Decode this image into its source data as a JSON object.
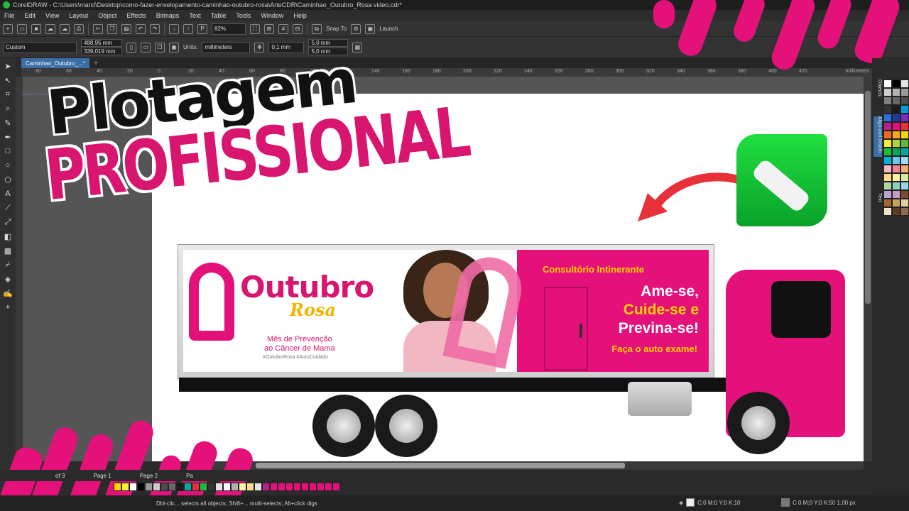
{
  "window": {
    "title": "CorelDRAW - C:\\Users\\marci\\Desktop\\como-fazer-envelopamento-caminhao-outubro-rosa\\ArteCDR\\Caminhao_Outubro_Rosa video.cdr*"
  },
  "menu": [
    "File",
    "Edit",
    "View",
    "Layout",
    "Object",
    "Effects",
    "Bitmaps",
    "Text",
    "Table",
    "Tools",
    "Window",
    "Help"
  ],
  "toolbar": {
    "zoom": "82%",
    "snap_to": "Snap To",
    "launch": "Launch"
  },
  "property_bar": {
    "page_size": "Custom",
    "width": "488,95 mm",
    "height": "339,019 mm",
    "units_label": "Units:",
    "units": "millimeters",
    "nudge": "0,1 mm",
    "dup_x": "5,0 mm",
    "dup_y": "5,0 mm"
  },
  "document_tab": "Caminhao_Outubro_...*",
  "ruler": {
    "labels": [
      "80",
      "60",
      "40",
      "20",
      "0",
      "20",
      "40",
      "60",
      "80",
      "100",
      "120",
      "140",
      "160",
      "180",
      "200",
      "220",
      "240",
      "260",
      "280",
      "300",
      "320",
      "340",
      "360",
      "380",
      "400",
      "420"
    ],
    "units": "millimeters"
  },
  "headline": {
    "line1": "Plotagem",
    "line2": "PROFISSIONAL"
  },
  "truck_banner": {
    "brand": "Outubro",
    "brand_sub": "Rosa",
    "slogan_1": "Mês de Prevenção",
    "slogan_2": "ao Câncer de Mama",
    "tags": "#OutubroRosa  #AutoCuidado",
    "consult": "Consultório Intinerante",
    "msg_1": "Ame-se,",
    "msg_2": "Cuide-se e",
    "msg_3": "Previna-se!",
    "msg_sub": "Faça o auto exame!"
  },
  "dock_tabs": [
    "Objects",
    "Align and Distrib...",
    "Text"
  ],
  "pages": {
    "counter": "of 3",
    "tabs": [
      "Page 1",
      "Page 2",
      "Pa"
    ]
  },
  "status": {
    "hint": "Dbl-clic... selects all objects; Shift+... multi-selects; Alt+click digs",
    "fill": "C:0 M:0 Y:0 K:10",
    "outline": "C:0 M:0 Y:0 K:50  1,00 px"
  },
  "colors": {
    "brand_pink": "#e4117a",
    "accent_yellow": "#ffd400",
    "corel_green": "#1cbc3c"
  },
  "palette": [
    "#ffffff",
    "#000000",
    "#e5e5e5",
    "#cccccc",
    "#b3b3b3",
    "#999999",
    "#808080",
    "#666666",
    "#4d4d4d",
    "#333333",
    "#1a1a1a",
    "#00a0e0",
    "#2d6fd8",
    "#1a3c9c",
    "#7b2ac2",
    "#b81e8c",
    "#e4117a",
    "#e8303a",
    "#f26a1f",
    "#f9a51b",
    "#ffd400",
    "#f5ee30",
    "#b5d334",
    "#5fb83f",
    "#1cbc3c",
    "#00a65a",
    "#00a99d",
    "#00b2d6",
    "#6ec6ef",
    "#a3d8f2",
    "#f6b7c9",
    "#f0878f",
    "#f7a977",
    "#ffd98a",
    "#fff3a3",
    "#d9e9a2",
    "#a9d89c",
    "#8dcfc2",
    "#9dd3e6",
    "#b7a4d3",
    "#c89bc5",
    "#7a4a2b",
    "#a0672e",
    "#c8a15c",
    "#e0cda0",
    "#ede3c5",
    "#5b3a26",
    "#8c6a4a"
  ],
  "doc_palette": [
    "#ffd400",
    "#f5ee30",
    "#ffffff",
    "#000000",
    "#999999",
    "#cccccc",
    "#4d4d4d",
    "#666666",
    "#1a1a1a",
    "#00a99d",
    "#e8303a",
    "#1cbc3c",
    "#333333",
    "#e5e5e5",
    "#ffffff",
    "#b3b3b3",
    "#fff3a3",
    "#ffd98a",
    "#e5e5e5",
    "#b81e8c",
    "#e4117a",
    "#e4117a",
    "#e4117a",
    "#e4117a",
    "#e4117a",
    "#e4117a",
    "#e4117a",
    "#e4117a",
    "#e4117a"
  ]
}
